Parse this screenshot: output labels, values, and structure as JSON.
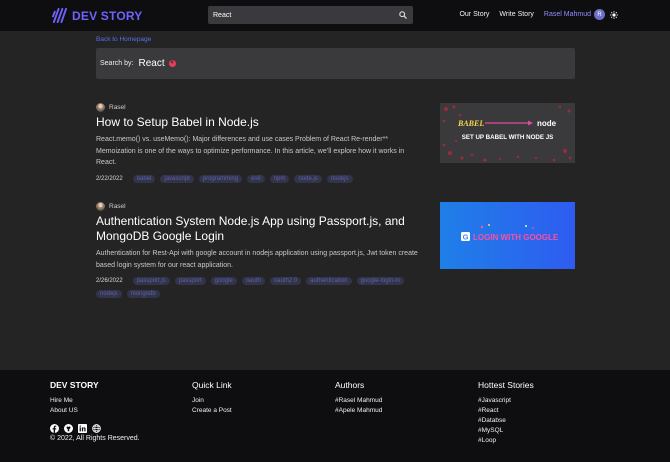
{
  "header": {
    "logo_text": "DEV STORY",
    "search_value": "React",
    "nav": {
      "our_story": "Our Story",
      "write_story": "Write Story",
      "user_name": "Rasel Mahmud",
      "avatar_initial": "R"
    }
  },
  "main": {
    "back_link": "Back to Homepage",
    "search_by_label": "Search by:",
    "search_term": "React",
    "clear_symbol": "×"
  },
  "posts": [
    {
      "author": "Rasel",
      "title": "How to Setup Babel in Node.js",
      "description": "React.memo() vs. useMemo(): Major differences and use cases Problem of React Re-render** Memoization is one of the ways to optimize performance. In this article, we’ll explore how it works in React.",
      "date": "2/22/2022",
      "tags": [
        "babel",
        "javascript",
        "programming",
        "es6",
        "npm",
        "node.js",
        "nodejs"
      ],
      "thumb": {
        "word1": "BABEL",
        "word2": "node",
        "caption": "SET UP BABEL WITH NODE JS"
      }
    },
    {
      "author": "Rasel",
      "title": "Authentication System Node.js App using Passport.js, and MongoDB Google Login",
      "description": "Authentication for Rest-Api with google account in nodejs application using passport.js, Jwt token create based login system for our react application.",
      "date": "2/26/2022",
      "tags": [
        "passport.js",
        "passport",
        "google",
        "oauth",
        "oauth2.0",
        "authentication",
        "google-login-in",
        "nodejs",
        "mongodb"
      ],
      "thumb": {
        "caption": "LOGIN WITH GOOGLE",
        "g": "G"
      }
    }
  ],
  "footer": {
    "brand": {
      "title": "DEV STORY",
      "links": [
        "Hire Me",
        "About US"
      ],
      "copyright": "© 2022, All Rights Reserved."
    },
    "quick_link": {
      "title": "Quick Link",
      "links": [
        "Join",
        "Create a Post"
      ]
    },
    "authors": {
      "title": "Authors",
      "links": [
        "#Rasel Mahmud",
        "#Apele Mahmud"
      ]
    },
    "hottest": {
      "title": "Hottest Stories",
      "links": [
        "#Javascript",
        "#React",
        "#Databse",
        "#MySQL",
        "#Loop"
      ]
    }
  },
  "colors": {
    "accent": "#6e63ff",
    "header_bg": "#0e0e10",
    "body_bg": "#242424",
    "tag_bg": "#333349",
    "tag_text": "#5b63a8",
    "clear_red": "#f03c5a"
  },
  "icons": [
    "logo-mark-icon",
    "search-icon",
    "sun-icon",
    "close-icon",
    "facebook-icon",
    "github-icon",
    "linkedin-icon",
    "globe-icon"
  ]
}
